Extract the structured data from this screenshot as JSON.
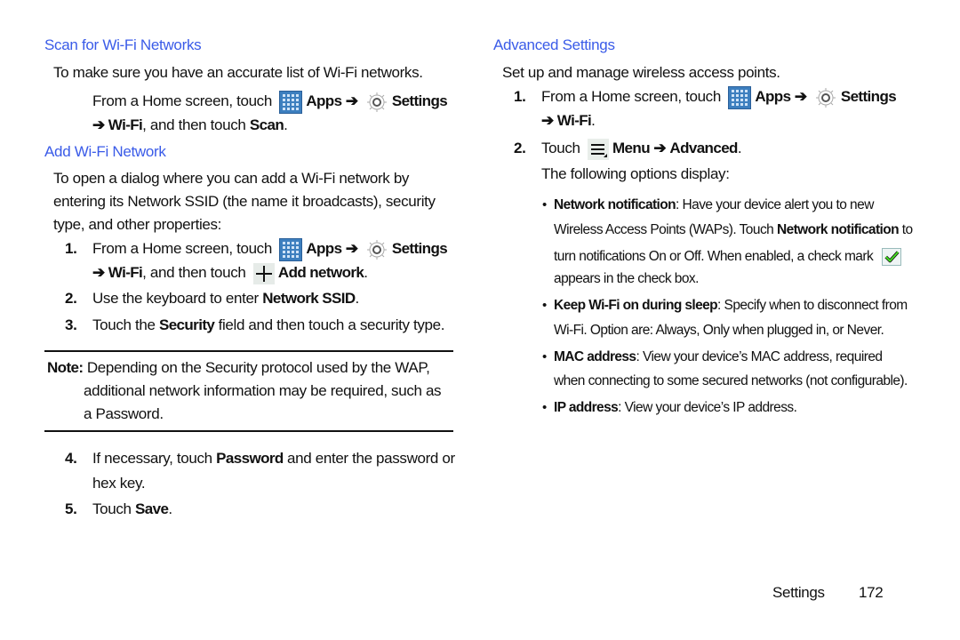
{
  "left": {
    "scan": {
      "heading": "Scan for Wi-Fi Networks",
      "intro": "To make sure you have an accurate list of Wi-Fi networks.",
      "step_a": "From a Home screen, touch",
      "apps": "Apps",
      "arrow": "➔",
      "settings": "Settings",
      "step_b_prefix": "➔ ",
      "wifi": "Wi-Fi",
      "step_b_mid": ", and then touch ",
      "scan": "Scan",
      "period": "."
    },
    "add": {
      "heading": "Add Wi-Fi Network",
      "intro_lines": [
        "To open a dialog where you can add a Wi-Fi network by",
        "entering its Network SSID (the name it broadcasts), security",
        "type, and other properties:"
      ],
      "steps": [
        {
          "num": "1.",
          "text": "From a Home screen, touch",
          "apps": "Apps",
          "arrow": "➔",
          "settings": "Settings",
          "line2_prefix": "➔ ",
          "wifi": "Wi-Fi",
          "line2_mid": ", and then touch",
          "add_network": "Add network",
          "end": "."
        },
        {
          "num": "2.",
          "pre": "Use the keyboard to enter ",
          "bold": "Network SSID",
          "post": "."
        },
        {
          "num": "3.",
          "pre": "Touch the ",
          "bold": "Security",
          "post": " field and then touch a security type."
        }
      ],
      "note": {
        "label": "Note:",
        "lines": [
          " Depending on the Security protocol used by the WAP,",
          "additional network information may be required, such as",
          "a Password."
        ]
      },
      "steps2": [
        {
          "num": "4.",
          "pre": "If necessary, touch ",
          "bold": "Password",
          "post": " and enter the password or",
          "line2": "hex key."
        },
        {
          "num": "5.",
          "pre": "Touch ",
          "bold": "Save",
          "post": "."
        }
      ]
    }
  },
  "right": {
    "heading": "Advanced Settings",
    "intro": "Set up and manage wireless access points.",
    "steps": [
      {
        "num": "1.",
        "text": "From a Home screen, touch",
        "apps": "Apps",
        "arrow": "➔",
        "settings": "Settings",
        "line2_prefix": "➔ ",
        "wifi": "Wi-Fi",
        "end": "."
      },
      {
        "num": "2.",
        "pre": "Touch",
        "menu": "Menu",
        "arrow": "➔",
        "advanced": "Advanced",
        "end": ".",
        "line2": "The following options display:"
      }
    ],
    "options": [
      {
        "bold": "Network notification",
        "lines": [
          ": Have your device alert you to new",
          "Wireless Access Points (WAPs). Touch ",
          "Network notification",
          " to",
          "turn notifications On or Off. When enabled, a check mark",
          "appears in the check box."
        ]
      },
      {
        "bold": "Keep Wi-Fi on during sleep",
        "lines": [
          ": Specify when to disconnect from",
          "Wi-Fi. Option are: Always, Only when plugged in, or Never."
        ]
      },
      {
        "bold": "MAC address",
        "lines": [
          ": View your device’s MAC address, required",
          "when connecting to some secured networks (not configurable)."
        ]
      },
      {
        "bold": "IP address",
        "lines": [
          ": View your device’s IP address."
        ]
      }
    ],
    "bullet": "•"
  },
  "footer": {
    "section": "Settings",
    "page": "172"
  },
  "colors": {
    "heading": "#3a5be8",
    "text": "#111111",
    "apps_icon": "#3d7fbf",
    "check": "#33cc22"
  }
}
